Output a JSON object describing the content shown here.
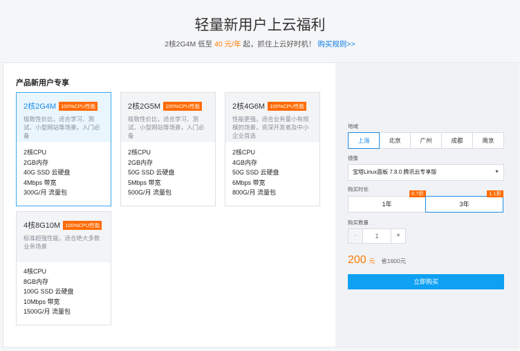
{
  "header": {
    "title": "轻量新用户上云福利",
    "subtitle_prefix": "2核2G4M 低至 ",
    "subtitle_price": "40 元/年",
    "subtitle_suffix": " 起，抓住上云好时机！",
    "rules_link": "购买规则>>"
  },
  "section_title": "产品新用户专享",
  "cards": [
    {
      "name": "2核2G4M",
      "badge": "100%CPU性能",
      "desc": "极致性价比，适合学习、测试、小型网站等场景，入门必备",
      "specs": [
        "2核CPU",
        "2GB内存",
        "40G SSD 云硬盘",
        "4Mbps 带宽",
        "300G/月 流量包"
      ]
    },
    {
      "name": "2核2G5M",
      "badge": "100%CPU性能",
      "desc": "极致性价比，适合学习、测试、小型网站等场景，入门必备",
      "specs": [
        "2核CPU",
        "2GB内存",
        "50G SSD 云硬盘",
        "5Mbps 带宽",
        "500G/月 流量包"
      ]
    },
    {
      "name": "2核4G6M",
      "badge": "100%CPU性能",
      "desc": "性能更强，适合业务量小有规模的场景，资深开发者及中小企业首选",
      "specs": [
        "2核CPU",
        "4GB内存",
        "50G SSD 云硬盘",
        "6Mbps 带宽",
        "800G/月 流量包"
      ]
    },
    {
      "name": "4核8G10M",
      "badge": "100%CPU性能",
      "desc": "标准超强性能，适合绝大多数业务场景",
      "specs": [
        "4核CPU",
        "8GB内存",
        "100G SSD 云硬盘",
        "10Mbps 带宽",
        "1500G/月 流量包"
      ]
    }
  ],
  "order": {
    "region_label": "地域",
    "regions": [
      "上海",
      "北京",
      "广州",
      "成都",
      "南京"
    ],
    "image_label": "镜像",
    "image_value": "宝塔Linux面板 7.8.0 腾讯云专享版",
    "duration_label": "购买时长",
    "durations": [
      {
        "label": "1年",
        "discount": "0.7折"
      },
      {
        "label": "3年",
        "discount": "1.1折"
      }
    ],
    "quantity_label": "购买数量",
    "quantity": "1",
    "minus": "-",
    "plus": "+",
    "price": "200",
    "price_unit": "元",
    "saving": "省1600元",
    "buy_label": "立即购买"
  }
}
